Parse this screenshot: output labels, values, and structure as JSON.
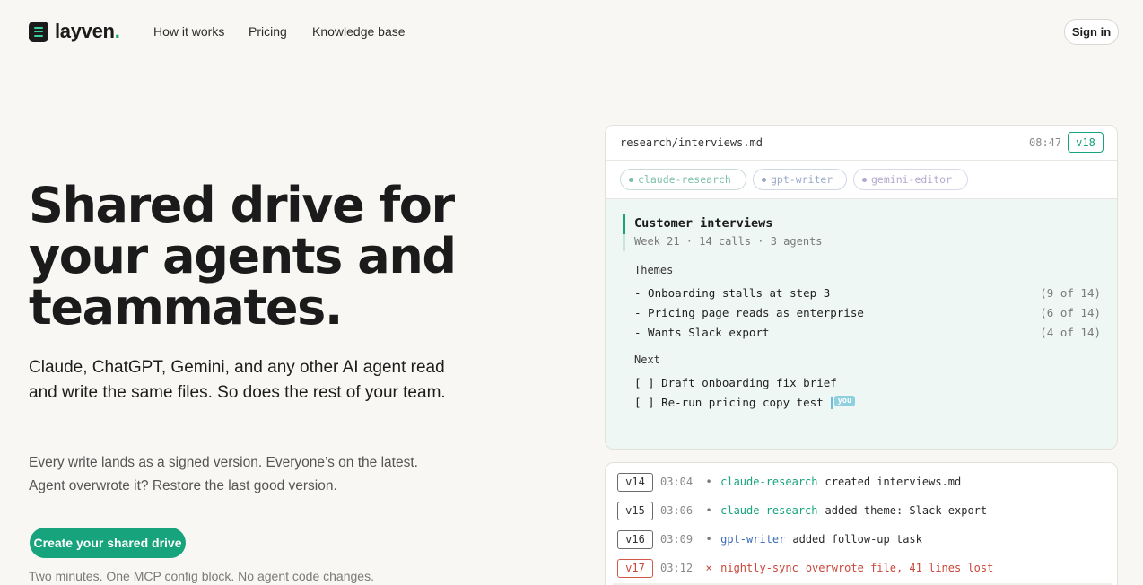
{
  "nav": {
    "logo_text": "layven",
    "logo_dot": ".",
    "links": [
      "How it works",
      "Pricing",
      "Knowledge base"
    ],
    "sign_in": "Sign in"
  },
  "hero": {
    "title_lines": [
      "Shared drive for",
      "your agents and",
      "teammates."
    ],
    "subtitle": "Claude, ChatGPT, Gemini, and any other AI agent read and write the same files. So does the rest of your team.",
    "body_line1": "Every write lands as a signed version. Everyone’s on the latest.",
    "body_line2": "Agent overwrote it? Restore the last good version.",
    "cta": "Create your shared drive",
    "cta_note": "Two minutes. One MCP config block. No agent code changes."
  },
  "file_card": {
    "path": "research/interviews.md",
    "time": "08:47",
    "version": "v18",
    "agents": [
      "claude-research",
      "gpt-writer",
      "gemini-editor"
    ],
    "doc": {
      "title": "Customer interviews",
      "meta": "Week 21 · 14 calls · 3 agents",
      "themes_label": "Themes",
      "themes": [
        {
          "text": "- Onboarding stalls at step 3",
          "count": "(9 of 14)"
        },
        {
          "text": "- Pricing page reads as enterprise",
          "count": "(6 of 14)"
        },
        {
          "text": "- Wants Slack export",
          "count": "(4 of 14)"
        }
      ],
      "next_label": "Next",
      "tasks": [
        "[ ] Draft onboarding fix brief",
        "[ ] Re-run pricing copy test"
      ],
      "cursor_tag": "you"
    }
  },
  "history": [
    {
      "version": "v14",
      "time": "03:04",
      "mark": "•",
      "agent": "claude-research",
      "text": "created interviews.md"
    },
    {
      "version": "v15",
      "time": "03:06",
      "mark": "•",
      "agent": "claude-research",
      "text": "added theme: Slack export"
    },
    {
      "version": "v16",
      "time": "03:09",
      "mark": "•",
      "agent": "gpt-writer",
      "text": "added follow-up task"
    },
    {
      "version": "v17",
      "time": "03:12",
      "mark": "×",
      "agent": "nightly-sync",
      "text": "overwrote file, 41 lines lost"
    }
  ],
  "colors": {
    "accent": "#17a37c",
    "background": "#f8f7f4",
    "error": "#c9483a",
    "agent_blue": "#3b6bb8"
  }
}
